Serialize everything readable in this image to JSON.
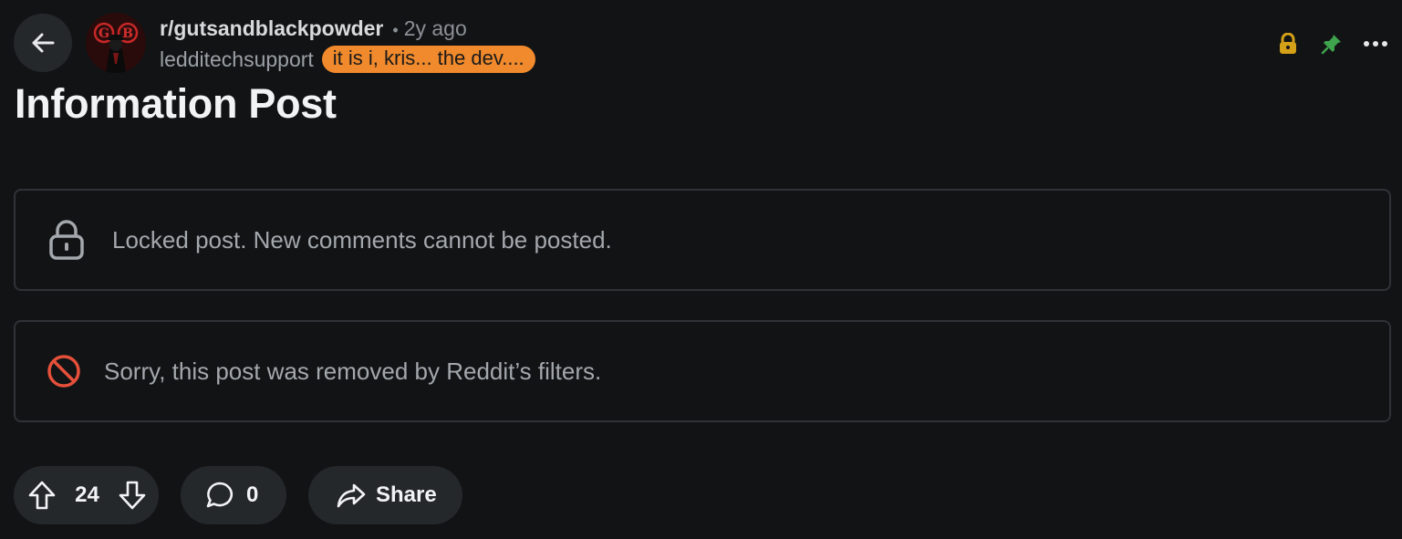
{
  "header": {
    "subreddit": "r/gutsandblackpowder",
    "separator": "•",
    "timestamp": "2y ago",
    "author": "ledditechsupport",
    "flair": "it is i, kris... the dev....",
    "avatar_text": "GB"
  },
  "post": {
    "title": "Information Post"
  },
  "notices": {
    "locked": "Locked post. New comments cannot be posted.",
    "removed": "Sorry, this post was removed by Reddit’s filters."
  },
  "actions": {
    "score": "24",
    "comments": "0",
    "share_label": "Share"
  },
  "icons": {
    "back": "arrow-left-icon",
    "lock_status": "lock-icon",
    "pin_status": "pin-icon",
    "more": "more-horizontal-icon",
    "notice_lock": "lock-icon",
    "notice_removed": "prohibited-icon",
    "upvote": "arrow-up-icon",
    "downvote": "arrow-down-icon",
    "comment": "comment-bubble-icon",
    "share": "share-arrow-icon"
  },
  "colors": {
    "background": "#121315",
    "flair": "#f08a2c",
    "lock_status": "#d4a017",
    "pin_status": "#3fa34d",
    "removed_icon": "#e5503a"
  }
}
